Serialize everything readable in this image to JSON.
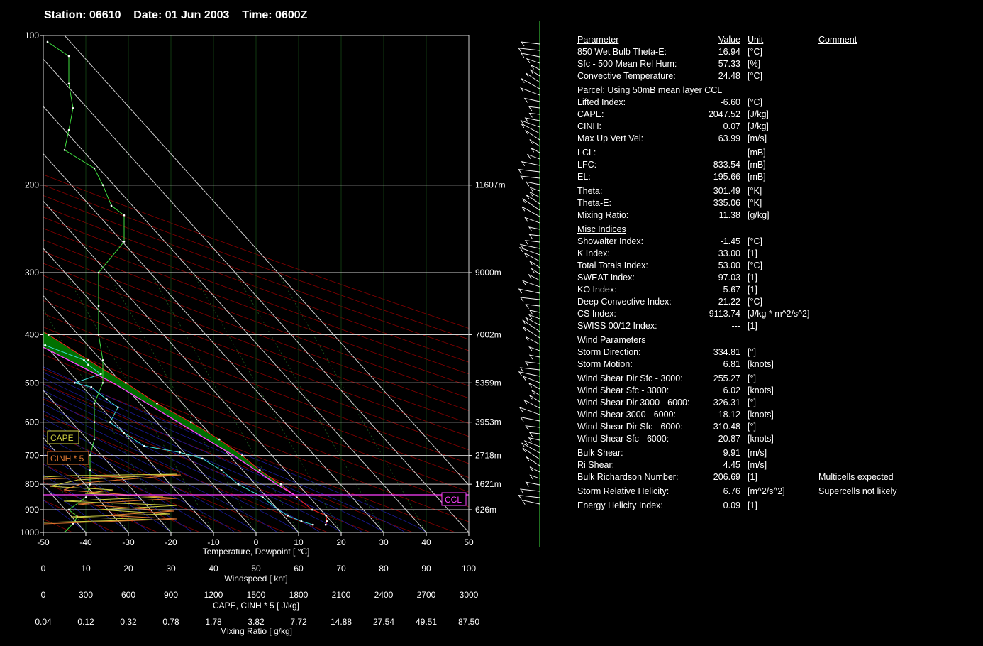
{
  "header": {
    "station": "Station: 06610",
    "date": "Date: 01 Jun 2003",
    "time": "Time: 0600Z"
  },
  "chart_data": {
    "type": "skew-t",
    "xlabel": "Temperature, Dewpoint [ °C]",
    "temp_ticks": [
      -50,
      -40,
      -30,
      -20,
      -10,
      0,
      10,
      20,
      30,
      40,
      50
    ],
    "pressure_ticks": [
      100,
      200,
      300,
      400,
      500,
      600,
      700,
      800,
      900,
      1000
    ],
    "height_labels": [
      {
        "p": 200,
        "label": "11607m"
      },
      {
        "p": 300,
        "label": "9000m"
      },
      {
        "p": 400,
        "label": "7002m"
      },
      {
        "p": 500,
        "label": "5359m"
      },
      {
        "p": 600,
        "label": "3953m"
      },
      {
        "p": 700,
        "label": "2718m"
      },
      {
        "p": 800,
        "label": "1621m"
      },
      {
        "p": 900,
        "label": "626m"
      }
    ],
    "temperature_profile": [
      [
        965,
        18
      ],
      [
        950,
        19
      ],
      [
        925,
        20
      ],
      [
        900,
        18
      ],
      [
        850,
        17
      ],
      [
        800,
        16
      ],
      [
        750,
        14
      ],
      [
        700,
        13
      ],
      [
        650,
        11
      ],
      [
        600,
        8
      ],
      [
        550,
        4
      ],
      [
        500,
        1
      ],
      [
        450,
        -3
      ],
      [
        400,
        -7
      ],
      [
        350,
        -12
      ],
      [
        300,
        -17
      ],
      [
        270,
        -21
      ],
      [
        250,
        -26
      ],
      [
        230,
        -31
      ],
      [
        210,
        -35
      ],
      [
        200,
        -37
      ],
      [
        190,
        -40
      ],
      [
        180,
        -41
      ],
      [
        170,
        -43
      ],
      [
        160,
        -48
      ],
      [
        150,
        -52
      ],
      [
        140,
        -58
      ],
      [
        130,
        -63
      ],
      [
        120,
        -69
      ],
      [
        110,
        -75
      ]
    ],
    "dewpoint_profile": [
      [
        965,
        15
      ],
      [
        950,
        13
      ],
      [
        925,
        11
      ],
      [
        900,
        10
      ],
      [
        850,
        9
      ],
      [
        800,
        6
      ],
      [
        750,
        5
      ],
      [
        710,
        3
      ],
      [
        690,
        -1
      ],
      [
        670,
        -8
      ],
      [
        630,
        -10
      ],
      [
        600,
        -11
      ],
      [
        560,
        -6
      ],
      [
        540,
        -7
      ],
      [
        510,
        -8
      ],
      [
        500,
        -11
      ],
      [
        480,
        -3
      ],
      [
        460,
        -4
      ],
      [
        450,
        -4
      ],
      [
        420,
        -10
      ],
      [
        400,
        -23
      ],
      [
        390,
        -27
      ],
      [
        370,
        -27
      ],
      [
        350,
        -25
      ],
      [
        320,
        -26
      ],
      [
        300,
        -28
      ],
      [
        280,
        -29
      ],
      [
        260,
        -31
      ],
      [
        240,
        -34
      ],
      [
        225,
        -36
      ],
      [
        210,
        -38
      ],
      [
        200,
        -38
      ]
    ],
    "parcel_profile": [
      [
        840,
        17
      ],
      [
        800,
        15
      ],
      [
        700,
        11
      ],
      [
        600,
        5
      ],
      [
        500,
        -2
      ],
      [
        400,
        -14
      ],
      [
        300,
        -31
      ],
      [
        250,
        -42
      ],
      [
        200,
        -56
      ],
      [
        150,
        -67
      ],
      [
        110,
        -79
      ],
      [
        100,
        -82
      ]
    ],
    "wind_speed_profile_knt": [
      [
        1000,
        5
      ],
      [
        960,
        7
      ],
      [
        930,
        8
      ],
      [
        900,
        6
      ],
      [
        850,
        10
      ],
      [
        800,
        11
      ],
      [
        750,
        11
      ],
      [
        700,
        11
      ],
      [
        650,
        12
      ],
      [
        600,
        12
      ],
      [
        550,
        12
      ],
      [
        500,
        14
      ],
      [
        450,
        14
      ],
      [
        400,
        13
      ],
      [
        350,
        13
      ],
      [
        300,
        13
      ],
      [
        260,
        19
      ],
      [
        230,
        19
      ],
      [
        220,
        16
      ],
      [
        200,
        14
      ],
      [
        185,
        12
      ],
      [
        170,
        5
      ],
      [
        155,
        6
      ],
      [
        140,
        7
      ],
      [
        125,
        6
      ],
      [
        110,
        6
      ],
      [
        103,
        1
      ]
    ],
    "wind_axis": {
      "label": "Windspeed [ knt]",
      "ticks": [
        0,
        10,
        20,
        30,
        40,
        50,
        60,
        70,
        80,
        90,
        100
      ]
    },
    "cape_axis": {
      "label": "CAPE, CINH * 5 [ J/kg]",
      "ticks": [
        0,
        300,
        600,
        900,
        1200,
        1500,
        1800,
        2100,
        2400,
        2700,
        3000
      ]
    },
    "mixing_axis": {
      "label": "Mixing Ratio [ g/kg]",
      "ticks": [
        "0.04",
        "0.12",
        "0.32",
        "0.78",
        "1.78",
        "3.82",
        "7.72",
        "14.88",
        "27.54",
        "49.51",
        "87.50"
      ]
    },
    "legend": {
      "cape": "CAPE",
      "cinh": "CINH * 5",
      "ccl": "CCL"
    },
    "ccl_pressure": 840,
    "series_colors": {
      "temperature": "#ff2020",
      "dewpoint": "#40e0e0",
      "parcel": "#ff40ff",
      "wind": "#40e040",
      "cape_fill": "#007000"
    }
  },
  "params": {
    "header": {
      "parameter": "Parameter",
      "value": "Value",
      "unit": "Unit",
      "comment": "Comment"
    },
    "sections": [
      {
        "title": "",
        "rows": [
          {
            "label": "850 Wet Bulb Theta-E:",
            "value": "16.94",
            "unit": "[°C]",
            "comment": ""
          },
          {
            "label": "Sfc - 500 Mean Rel Hum:",
            "value": "57.33",
            "unit": "[%]",
            "comment": ""
          },
          {
            "label": "Convective Temperature:",
            "value": "24.48",
            "unit": "[°C]",
            "comment": ""
          }
        ]
      },
      {
        "title": "Parcel: Using 50mB mean layer CCL",
        "rows": [
          {
            "label": "Lifted Index:",
            "value": "-6.60",
            "unit": "[°C]",
            "comment": ""
          },
          {
            "label": "CAPE:",
            "value": "2047.52",
            "unit": "[J/kg]",
            "comment": ""
          },
          {
            "label": "CINH:",
            "value": "0.07",
            "unit": "[J/kg]",
            "comment": ""
          },
          {
            "label": "Max Up Vert Vel:",
            "value": "63.99",
            "unit": "[m/s]",
            "comment": ""
          },
          {
            "gap": true
          },
          {
            "label": "LCL:",
            "value": "---",
            "unit": "[mB]",
            "comment": ""
          },
          {
            "label": "LFC:",
            "value": "833.54",
            "unit": "[mB]",
            "comment": ""
          },
          {
            "label": "EL:",
            "value": "195.66",
            "unit": "[mB]",
            "comment": ""
          },
          {
            "gap": true
          },
          {
            "label": "Theta:",
            "value": "301.49",
            "unit": "[°K]",
            "comment": ""
          },
          {
            "label": "Theta-E:",
            "value": "335.06",
            "unit": "[°K]",
            "comment": ""
          },
          {
            "label": "Mixing Ratio:",
            "value": "11.38",
            "unit": "[g/kg]",
            "comment": ""
          }
        ]
      },
      {
        "title": "Misc Indices",
        "rows": [
          {
            "label": "Showalter Index:",
            "value": "-1.45",
            "unit": "[°C]",
            "comment": ""
          },
          {
            "label": "K Index:",
            "value": "33.00",
            "unit": "[1]",
            "comment": ""
          },
          {
            "label": "Total Totals Index:",
            "value": "53.00",
            "unit": "[°C]",
            "comment": ""
          },
          {
            "label": "SWEAT Index:",
            "value": "97.03",
            "unit": "[1]",
            "comment": ""
          },
          {
            "label": "KO Index:",
            "value": "-5.67",
            "unit": "[1]",
            "comment": ""
          },
          {
            "label": "Deep Convective Index:",
            "value": "21.22",
            "unit": "[°C]",
            "comment": ""
          },
          {
            "label": "CS Index:",
            "value": "9113.74",
            "unit": "[J/kg * m^2/s^2]",
            "comment": ""
          },
          {
            "label": "SWISS 00/12 Index:",
            "value": "---",
            "unit": "[1]",
            "comment": ""
          }
        ]
      },
      {
        "title": "Wind Parameters",
        "rows": [
          {
            "label": "Storm Direction:",
            "value": "334.81",
            "unit": "[°]",
            "comment": ""
          },
          {
            "label": "Storm Motion:",
            "value": "6.81",
            "unit": "[knots]",
            "comment": ""
          },
          {
            "gap": true
          },
          {
            "label": "Wind Shear Dir Sfc - 3000:",
            "value": "255.27",
            "unit": "[°]",
            "comment": ""
          },
          {
            "label": "Wind Shear Sfc - 3000:",
            "value": "6.02",
            "unit": "[knots]",
            "comment": ""
          },
          {
            "label": "Wind Shear Dir 3000 - 6000:",
            "value": "326.31",
            "unit": "[°]",
            "comment": ""
          },
          {
            "label": "Wind Shear 3000 - 6000:",
            "value": "18.12",
            "unit": "[knots]",
            "comment": ""
          },
          {
            "label": "Wind Shear Dir Sfc - 6000:",
            "value": "310.48",
            "unit": "[°]",
            "comment": ""
          },
          {
            "label": "Wind Shear Sfc - 6000:",
            "value": "20.87",
            "unit": "[knots]",
            "comment": ""
          },
          {
            "gap": true
          },
          {
            "label": "Bulk Shear:",
            "value": "9.91",
            "unit": "[m/s]",
            "comment": ""
          },
          {
            "label": "Ri Shear:",
            "value": "4.45",
            "unit": "[m/s]",
            "comment": ""
          },
          {
            "label": "Bulk Richardson Number:",
            "value": "206.69",
            "unit": "[1]",
            "comment": "Multicells expected"
          },
          {
            "gap": true
          },
          {
            "label": "Storm Relative Helicity:",
            "value": "6.76",
            "unit": "[m^2/s^2]",
            "comment": "Supercells not likely"
          },
          {
            "gap": true
          },
          {
            "label": "Energy Helicity Index:",
            "value": "0.09",
            "unit": "[1]",
            "comment": ""
          }
        ]
      }
    ]
  }
}
